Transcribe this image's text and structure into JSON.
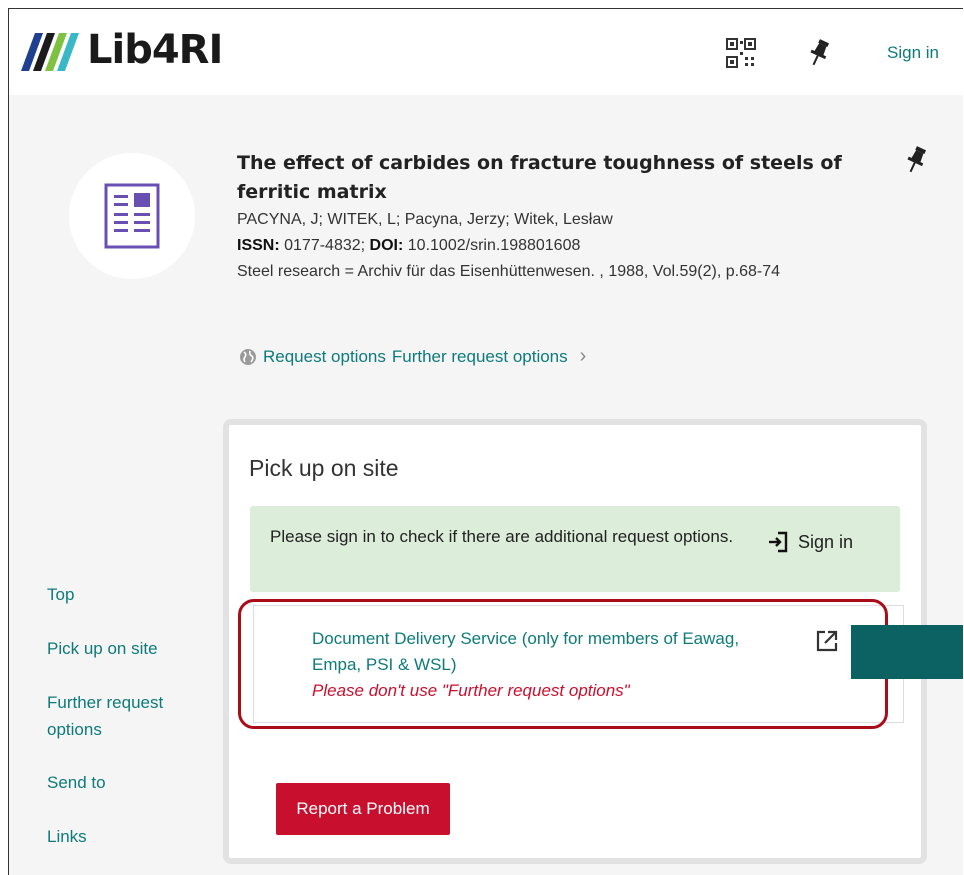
{
  "header": {
    "logo_text": "Lib4RI",
    "sign_in_label": "Sign in",
    "qr_icon": "qr-code-icon",
    "pin_icon": "pin-icon"
  },
  "record": {
    "title": "The effect of carbides on fracture toughness of steels of ferritic matrix",
    "authors": "PACYNA, J; WITEK, L; Pacyna, Jerzy; Witek, Lesław",
    "issn_label": "ISSN:",
    "issn_value": "0177-4832;",
    "doi_label": "DOI:",
    "doi_value": "10.1002/srin.198801608",
    "source": "Steel research = Archiv für das Eisenhüttenwesen. , 1988, Vol.59(2), p.68-74",
    "request_options_label": "Request options",
    "further_request_options_label": "Further request options",
    "chevron": "›"
  },
  "sidenav": {
    "items": [
      "Top",
      "Pick up on site",
      "Further request options",
      "Send to",
      "Links"
    ]
  },
  "panel": {
    "title": "Pick up on site",
    "signin_message": "Please sign in to check if there are additional request options.",
    "signin_action": "Sign in",
    "dds_link": "Document Delivery Service (only for members of Eawag, Empa, PSI & WSL)",
    "dds_note": "Please don't use \"Further request options\"",
    "report_button": "Report a Problem"
  },
  "colors": {
    "teal": "#0e7a7a",
    "red": "#c8102e",
    "green_box": "#dcedd9",
    "highlight": "#a80d18"
  }
}
